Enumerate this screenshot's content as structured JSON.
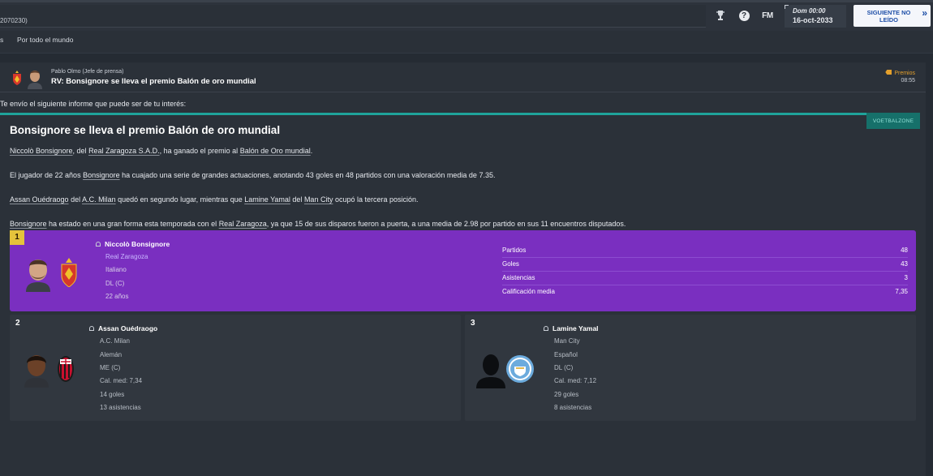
{
  "topbar": {
    "url_fragment": "2070230)",
    "help_glyph": "?",
    "fm_logo": "FM",
    "time": "Dom 00:00",
    "date": "16-oct-2033",
    "next_button": "SIGUIENTE NO LEÍDO",
    "next_chevron": "»"
  },
  "subnav": {
    "items": [
      "s",
      "Por todo el mundo"
    ]
  },
  "message": {
    "sender": "Pablo Olmo  (Jefe de prensa)",
    "subject": "RV: Bonsignore se lleva el premio Balón de oro mundial",
    "tag": "Premios",
    "time": "08:55",
    "intro": "Te envío el siguiente informe que puede ser de tu interés:"
  },
  "article": {
    "source": "VOETBALZONE",
    "headline": "Bonsignore se lleva el premio Balón de oro mundial",
    "p1": {
      "a": "Niccolò Bonsignore",
      "b": ", del ",
      "c": "Real Zaragoza S.A.D.",
      "d": ", ha ganado el premio al ",
      "e": "Balón de Oro mundial",
      "f": "."
    },
    "p2": {
      "a": "El jugador de 22 años ",
      "b": "Bonsignore",
      "c": " ha cuajado una serie de grandes actuaciones, anotando 43 goles en 48 partidos con una valoración media de 7.35."
    },
    "p3": {
      "a": "Assan Ouédraogo",
      "b": " del ",
      "c": "A.C. Milan",
      "d": " quedó en segundo lugar, mientras que ",
      "e": "Lamine Yamal",
      "f": " del ",
      "g": "Man City",
      "h": " ocupó la tercera posición."
    },
    "p4": {
      "a": "Bonsignore",
      "b": " ha estado en una gran forma esta temporada con el ",
      "c": "Real Zaragoza",
      "d": ", ya que 15 de sus disparos fueron a puerta, a una media de 2.98 por partido en sus 11 encuentros disputados."
    }
  },
  "winner": {
    "rank": "1",
    "name": "Niccolò Bonsignore",
    "club": "Real Zaragoza",
    "nationality": "Italiano",
    "position": "DL (C)",
    "age": "22 años",
    "stats": [
      {
        "label": "Partidos",
        "value": "48"
      },
      {
        "label": "Goles",
        "value": "43"
      },
      {
        "label": "Asistencias",
        "value": "3"
      },
      {
        "label": "Calificación media",
        "value": "7,35"
      }
    ]
  },
  "second": {
    "rank": "2",
    "name": "Assan Ouédraogo",
    "club": "A.C. Milan",
    "nationality": "Alemán",
    "position": "ME (C)",
    "rating": "Cal. med: 7,34",
    "goals": "14 goles",
    "assists": "13 asistencias"
  },
  "third": {
    "rank": "3",
    "name": "Lamine Yamal",
    "club": "Man City",
    "nationality": "Español",
    "position": "DL (C)",
    "rating": "Cal. med: 7,12",
    "goals": "29 goles",
    "assists": "8 asistencias"
  },
  "colors": {
    "winner_card": "#7a2fc0",
    "source_accent": "#1fa39a",
    "tag_orange": "#e4a02c",
    "rank_gold": "#e5c33b"
  }
}
